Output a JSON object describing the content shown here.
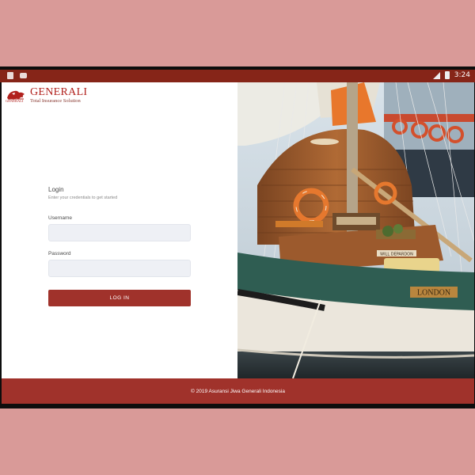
{
  "status_bar": {
    "time": "3:24",
    "notification_icons": [
      "android-icon",
      "message-icon"
    ]
  },
  "brand": {
    "name": "GENERALI",
    "tagline": "Total Insurance Solution",
    "logo_caption": "GENERALI"
  },
  "login": {
    "title": "Login",
    "subtitle": "Enter your credentials to get started",
    "username_label": "Username",
    "username_value": "",
    "password_label": "Password",
    "password_value": "",
    "button_label": "LOG IN"
  },
  "hero_image": {
    "boat_nameplate": "LONDON",
    "sign": "WILL DEPARDON"
  },
  "footer": {
    "copyright": "© 2019 Asuransi Jiwa Generali Indonesia"
  },
  "colors": {
    "primary": "#a0322b",
    "status_bar": "#862518",
    "page_bg": "#d99a98"
  }
}
